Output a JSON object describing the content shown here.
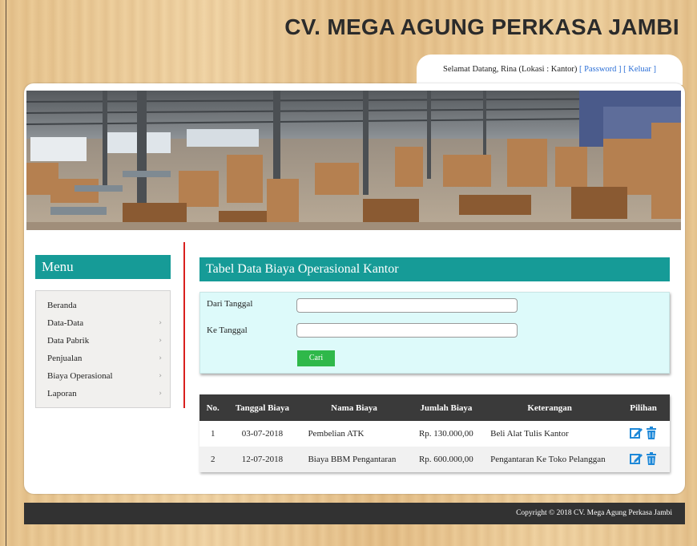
{
  "header": {
    "site_title": "CV. MEGA AGUNG PERKASA JAMBI",
    "welcome_text": "Selamat Datang, Rina (Lokasi : Kantor)",
    "password_link": "[ Password ]",
    "logout_link": "[ Keluar ]"
  },
  "sidebar": {
    "title": "Menu",
    "items": [
      {
        "label": "Beranda",
        "has_submenu": false
      },
      {
        "label": "Data-Data",
        "has_submenu": true
      },
      {
        "label": "Data Pabrik",
        "has_submenu": true
      },
      {
        "label": "Penjualan",
        "has_submenu": true
      },
      {
        "label": "Biaya Operasional",
        "has_submenu": true
      },
      {
        "label": "Laporan",
        "has_submenu": true
      }
    ]
  },
  "main": {
    "title": "Tabel Data Biaya Operasional Kantor",
    "filter": {
      "from_label": "Dari Tanggal",
      "from_value": "",
      "to_label": "Ke Tanggal",
      "to_value": "",
      "search_button": "Cari"
    },
    "table": {
      "headers": [
        "No.",
        "Tanggal Biaya",
        "Nama Biaya",
        "Jumlah Biaya",
        "Keterangan",
        "Pilihan"
      ],
      "rows": [
        {
          "no": "1",
          "tanggal": "03-07-2018",
          "nama": "Pembelian ATK",
          "jumlah": "Rp. 130.000,00",
          "keterangan": "Beli Alat Tulis Kantor"
        },
        {
          "no": "2",
          "tanggal": "12-07-2018",
          "nama": "Biaya BBM Pengantaran",
          "jumlah": "Rp. 600.000,00",
          "keterangan": "Pengantaran Ke Toko Pelanggan"
        }
      ],
      "action_icons": [
        "edit-icon",
        "delete-icon"
      ]
    }
  },
  "footer": {
    "copyright": "Copyright © 2018 CV. Mega Agung Perkasa Jambi"
  },
  "colors": {
    "accent_teal": "#169b97",
    "divider_red": "#d9201e",
    "button_green": "#2fb84a",
    "table_header": "#3a3a3a",
    "link_blue": "#2a6ed6",
    "icon_blue": "#1e88d8"
  }
}
